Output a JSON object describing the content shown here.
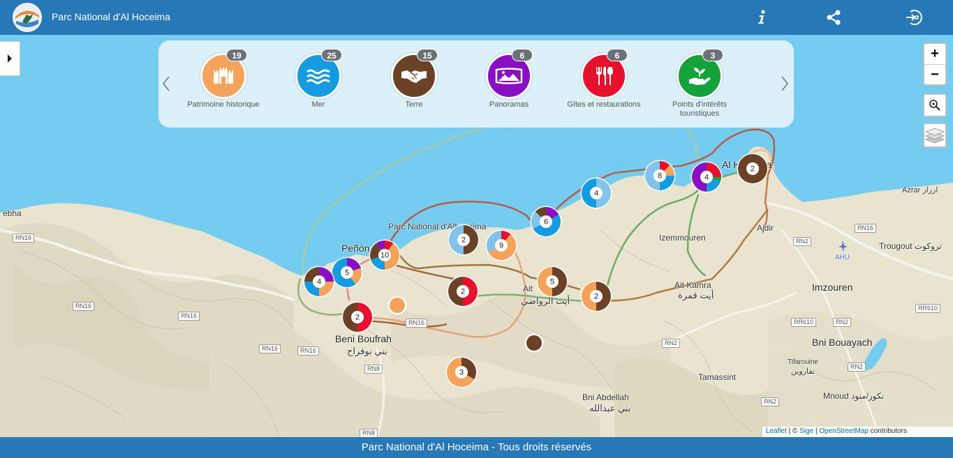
{
  "header": {
    "title": "Parc National d'Al Hoceima",
    "buttons": [
      {
        "name": "info",
        "icon": "info-icon"
      },
      {
        "name": "share",
        "icon": "share-icon"
      },
      {
        "name": "login",
        "icon": "login-icon"
      }
    ]
  },
  "categories": [
    {
      "label": "Patrimoine historique",
      "count": "19",
      "color": "#f5a35a",
      "icon": "monument-icon"
    },
    {
      "label": "Mer",
      "count": "25",
      "color": "#159be2",
      "icon": "waves-icon"
    },
    {
      "label": "Terre",
      "count": "15",
      "color": "#6b4226",
      "icon": "handshake-icon"
    },
    {
      "label": "Panoramas",
      "count": "6",
      "color": "#8a0fc4",
      "icon": "landscape-icon"
    },
    {
      "label": "Gîtes et restaurations",
      "count": "6",
      "color": "#e8112d",
      "icon": "cutlery-icon"
    },
    {
      "label": "Points d'intérêts touristiques",
      "count": "3",
      "color": "#14a33a",
      "icon": "plant-hand-icon"
    }
  ],
  "controls": {
    "zoom_in": "+",
    "zoom_out": "−"
  },
  "map_labels": [
    {
      "text": "Al Hoceima",
      "cls": "big"
    },
    {
      "text": "Azrar  ازرار",
      "cls": ""
    },
    {
      "text": "Izemmouren",
      "cls": ""
    },
    {
      "text": "Ajdir",
      "cls": ""
    },
    {
      "text": "Trougout تروكوت",
      "cls": ""
    },
    {
      "text": "AHU",
      "cls": ""
    },
    {
      "text": "Imzouren",
      "cls": ""
    },
    {
      "text": "Ait Kamra",
      "cls": ""
    },
    {
      "text": "أيت قمرة",
      "cls": "ar"
    },
    {
      "text": "Ait",
      "cls": ""
    },
    {
      "text": "أيت الرواضي",
      "cls": "ar"
    },
    {
      "text": "Parc National d'Alhoceima",
      "cls": ""
    },
    {
      "text": "Peñón",
      "cls": "big"
    },
    {
      "text": "Beni Boufrah",
      "cls": ""
    },
    {
      "text": "بني بوفراح",
      "cls": "ar"
    },
    {
      "text": "Bni Bouayach",
      "cls": ""
    },
    {
      "text": "Tifarouine",
      "cls": ""
    },
    {
      "text": "تفاروين",
      "cls": "ar"
    },
    {
      "text": "Tamassint",
      "cls": ""
    },
    {
      "text": "Mnoud نكور/منود",
      "cls": ""
    },
    {
      "text": "Bni Abdellah",
      "cls": ""
    },
    {
      "text": "بني عبدالله",
      "cls": "ar"
    },
    {
      "text": "ebha",
      "cls": ""
    }
  ],
  "road_shields": [
    "RN16",
    "RN16",
    "RN16",
    "RN16",
    "RN16",
    "RN16",
    "RN2",
    "RN2",
    "RN2",
    "RN2",
    "RN2",
    "RR610",
    "RR610",
    "RN8",
    "RN8",
    "RN16"
  ],
  "clusters": [
    {
      "count": "2",
      "segments": [
        [
          "#6b4226",
          1
        ]
      ]
    },
    {
      "count": "4",
      "segments": [
        [
          "#e8112d",
          0.25
        ],
        [
          "#14a33a",
          0.05
        ],
        [
          "#159be2",
          0.2
        ],
        [
          "#8a0fc4",
          0.5
        ]
      ]
    },
    {
      "count": "8",
      "segments": [
        [
          "#e8112d",
          0.12
        ],
        [
          "#f5a35a",
          0.13
        ],
        [
          "#159be2",
          0.25
        ],
        [
          "#80c4ee",
          0.5
        ]
      ]
    },
    {
      "count": "4",
      "segments": [
        [
          "#80c4ee",
          0.5
        ],
        [
          "#159be2",
          0.5
        ]
      ]
    },
    {
      "count": "6",
      "segments": [
        [
          "#8a0fc4",
          0.17
        ],
        [
          "#159be2",
          0.5
        ],
        [
          "#80c4ee",
          0.2
        ],
        [
          "#6b4226",
          0.13
        ]
      ]
    },
    {
      "count": "9",
      "segments": [
        [
          "#e8112d",
          0.11
        ],
        [
          "#f5a35a",
          0.56
        ],
        [
          "#80c4ee",
          0.33
        ]
      ]
    },
    {
      "count": "2",
      "segments": [
        [
          "#6b4226",
          0.5
        ],
        [
          "#80c4ee",
          0.5
        ]
      ]
    },
    {
      "count": "10",
      "segments": [
        [
          "#e8112d",
          0.1
        ],
        [
          "#f5a35a",
          0.4
        ],
        [
          "#159be2",
          0.2
        ],
        [
          "#6b4226",
          0.2
        ],
        [
          "#8a0fc4",
          0.1
        ]
      ]
    },
    {
      "count": "5",
      "segments": [
        [
          "#8a0fc4",
          0.2
        ],
        [
          "#f5a35a",
          0.2
        ],
        [
          "#159be2",
          0.6
        ]
      ]
    },
    {
      "count": "4",
      "segments": [
        [
          "#8a0fc4",
          0.25
        ],
        [
          "#f5a35a",
          0.25
        ],
        [
          "#159be2",
          0.25
        ],
        [
          "#6b4226",
          0.25
        ]
      ]
    },
    {
      "count": "2",
      "segments": [
        [
          "#e8112d",
          0.5
        ],
        [
          "#6b4226",
          0.5
        ]
      ]
    },
    {
      "count": "2",
      "segments": [
        [
          "#e8112d",
          0.5
        ],
        [
          "#6b4226",
          0.5
        ]
      ]
    },
    {
      "count": "5",
      "segments": [
        [
          "#6b4226",
          0.5
        ],
        [
          "#f5a35a",
          0.5
        ]
      ]
    },
    {
      "count": "2",
      "segments": [
        [
          "#6b4226",
          0.5
        ],
        [
          "#f5a35a",
          0.5
        ]
      ]
    },
    {
      "count": "3",
      "segments": [
        [
          "#6b4226",
          0.33
        ],
        [
          "#f5a35a",
          0.67
        ]
      ]
    },
    {
      "count": "",
      "segments": [
        [
          "#f5a35a",
          1
        ]
      ]
    },
    {
      "count": "",
      "segments": [
        [
          "#6b4226",
          1
        ]
      ]
    }
  ],
  "attribution": {
    "leaflet": "Leaflet",
    "sep1": " | © ",
    "sige": "Sige",
    "sep2": " | ",
    "osm": "OpenStreetMap",
    "suffix": " contributors"
  },
  "footer": {
    "text": "Parc National d'Al Hoceima - Tous droits réservés"
  }
}
